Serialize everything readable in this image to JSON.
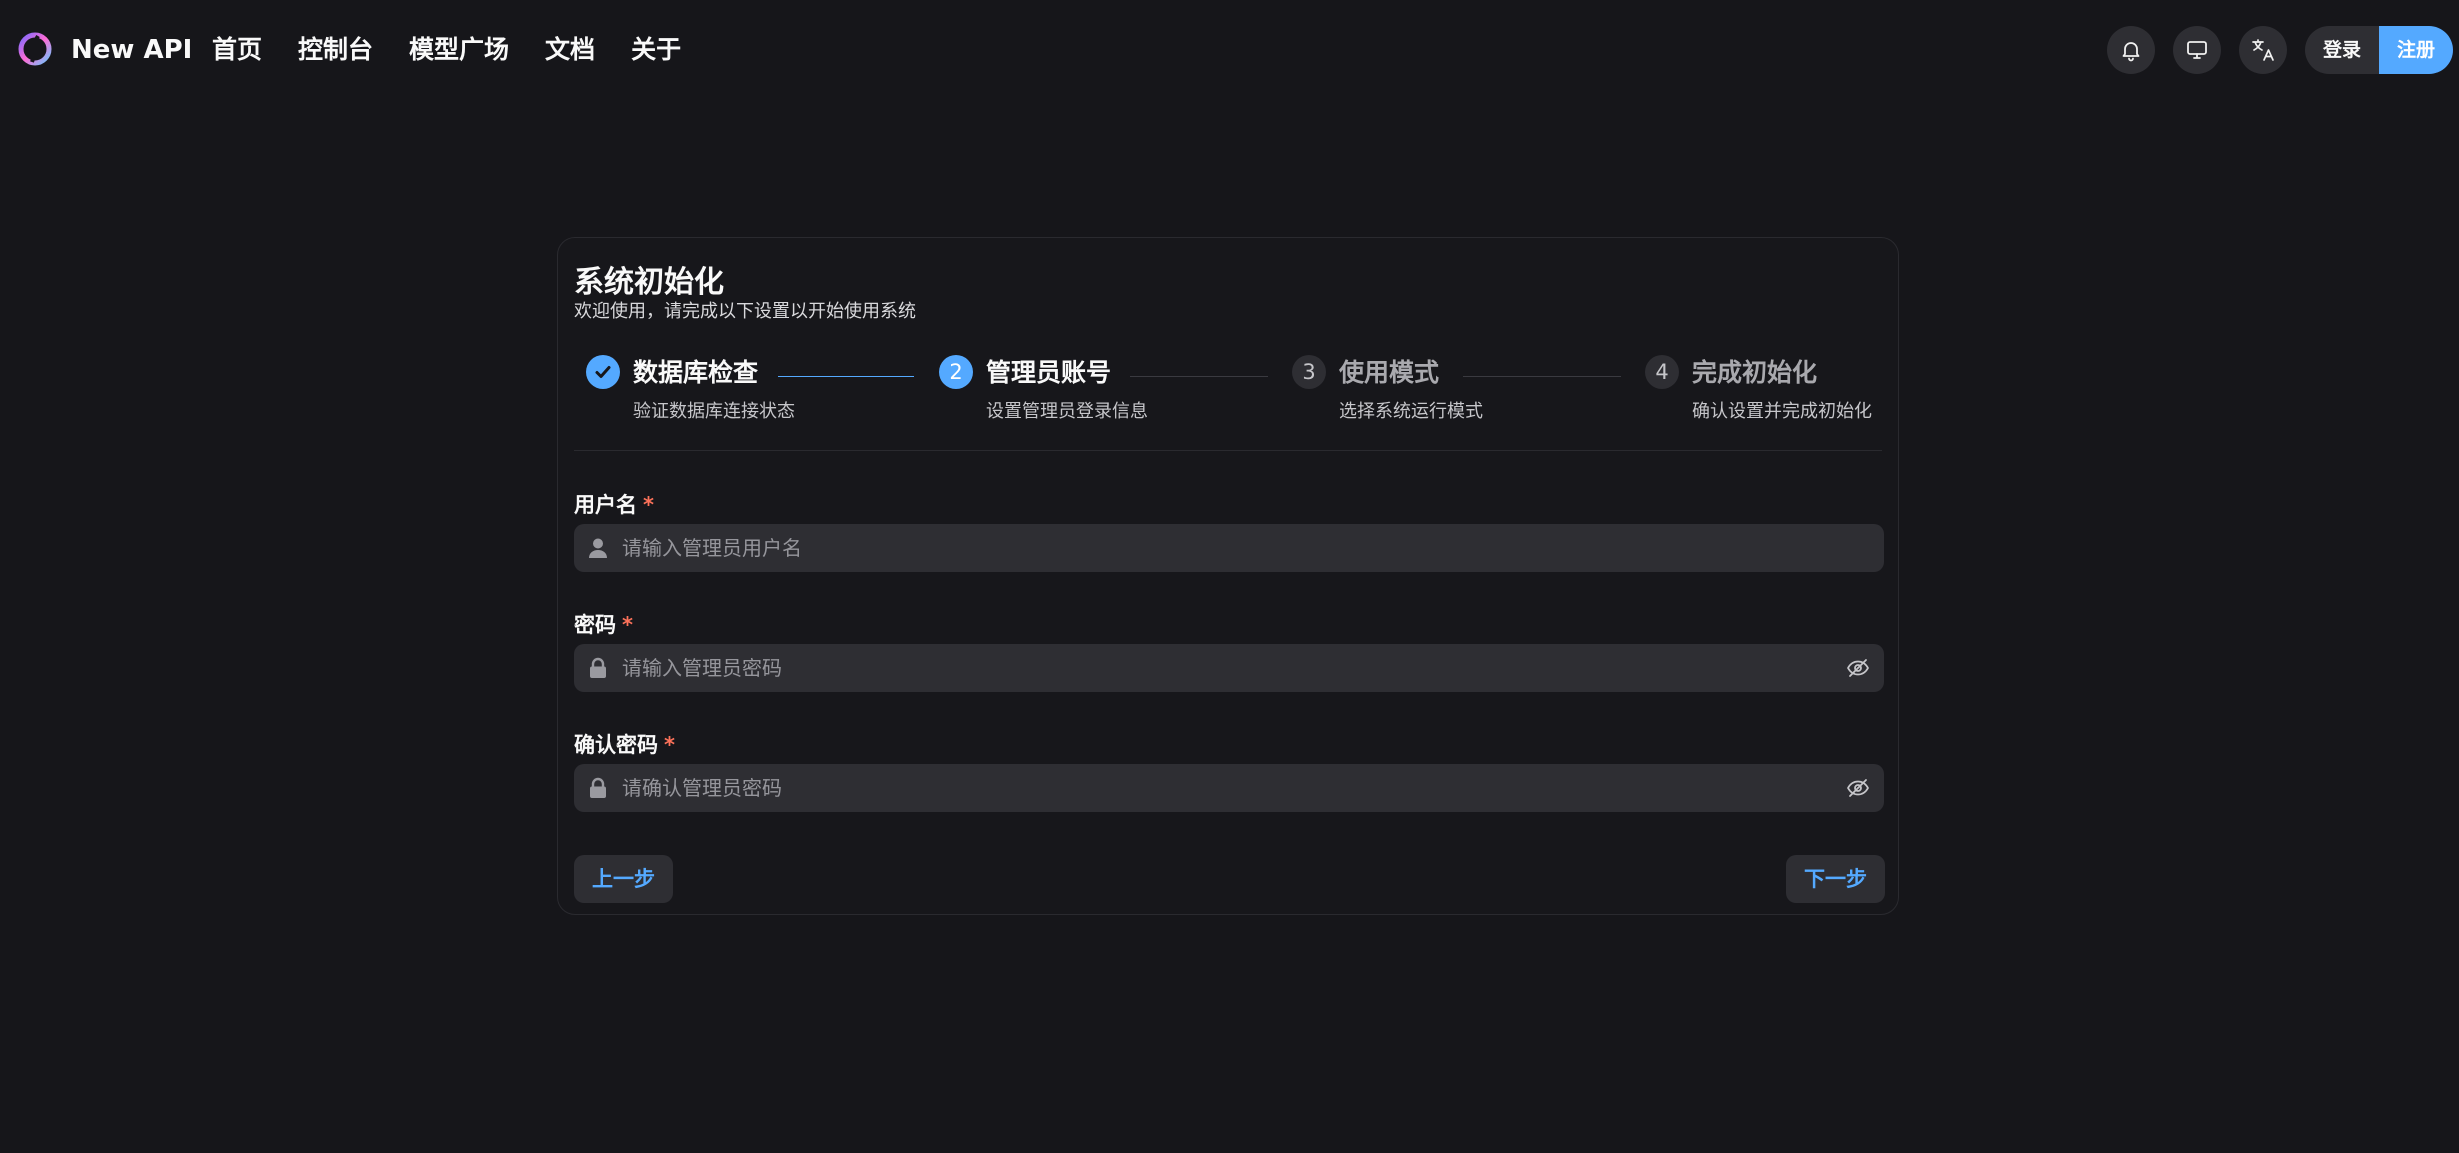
{
  "header": {
    "app_title": "New API",
    "logo_icon": "new-api-logo",
    "nav": [
      {
        "label": "首页"
      },
      {
        "label": "控制台"
      },
      {
        "label": "模型广场"
      },
      {
        "label": "文档"
      },
      {
        "label": "关于"
      }
    ],
    "icons": [
      "bell-icon",
      "monitor-icon",
      "translate-icon"
    ],
    "login_label": "登录",
    "register_label": "注册"
  },
  "setup": {
    "title": "系统初始化",
    "subtitle": "欢迎使用，请完成以下设置以开始使用系统",
    "steps": [
      {
        "number": "1",
        "title": "数据库检查",
        "desc": "验证数据库连接状态",
        "status": "finished"
      },
      {
        "number": "2",
        "title": "管理员账号",
        "desc": "设置管理员登录信息",
        "status": "current"
      },
      {
        "number": "3",
        "title": "使用模式",
        "desc": "选择系统运行模式",
        "status": "pending"
      },
      {
        "number": "4",
        "title": "完成初始化",
        "desc": "确认设置并完成初始化",
        "status": "pending"
      }
    ],
    "fields": {
      "username": {
        "label": "用户名",
        "required_mark": "*",
        "placeholder": "请输入管理员用户名",
        "value": ""
      },
      "password": {
        "label": "密码",
        "required_mark": "*",
        "placeholder": "请输入管理员密码",
        "value": ""
      },
      "confirm_password": {
        "label": "确认密码",
        "required_mark": "*",
        "placeholder": "请确认管理员密码",
        "value": ""
      }
    },
    "prev_label": "上一步",
    "next_label": "下一步"
  },
  "colors": {
    "background": "#16161a",
    "accent": "#54a9ff",
    "required": "#fc725a",
    "input_bg": "#2e2e33",
    "text": "#f9f9f9",
    "muted_text": "#96969c"
  }
}
